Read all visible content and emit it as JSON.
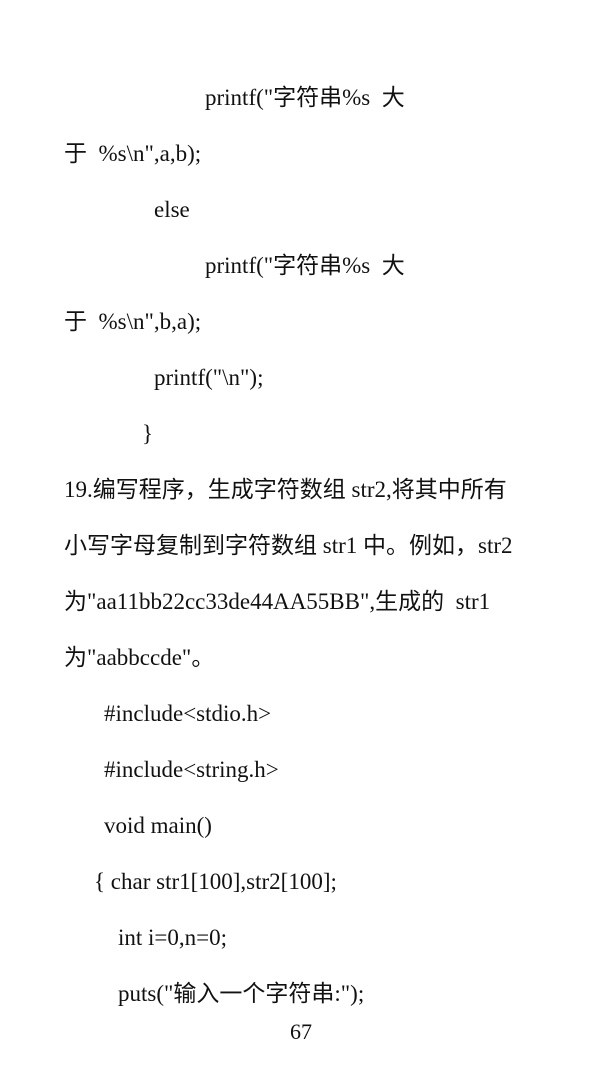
{
  "code_top": [
    "printf(\"字符串%s  大",
    "于  %s\\n\",a,b);",
    "else",
    "printf(\"字符串%s  大",
    "于  %s\\n\",b,a);",
    "printf(\"\\n\");",
    "}"
  ],
  "problem": {
    "lines": [
      "19.编写程序，生成字符数组 str2,将其中所有",
      "小写字母复制到字符数组 str1 中。例如，str2",
      "为\"aa11bb22cc33de44AA55BB\",生成的  str1",
      "为\"aabbccde\"。"
    ]
  },
  "code_bottom": [
    "#include<stdio.h>",
    "#include<string.h>",
    "void main()",
    "{ char str1[100],str2[100];",
    "int i=0,n=0;",
    "puts(\"输入一个字符串:\");"
  ],
  "page_number": "67"
}
